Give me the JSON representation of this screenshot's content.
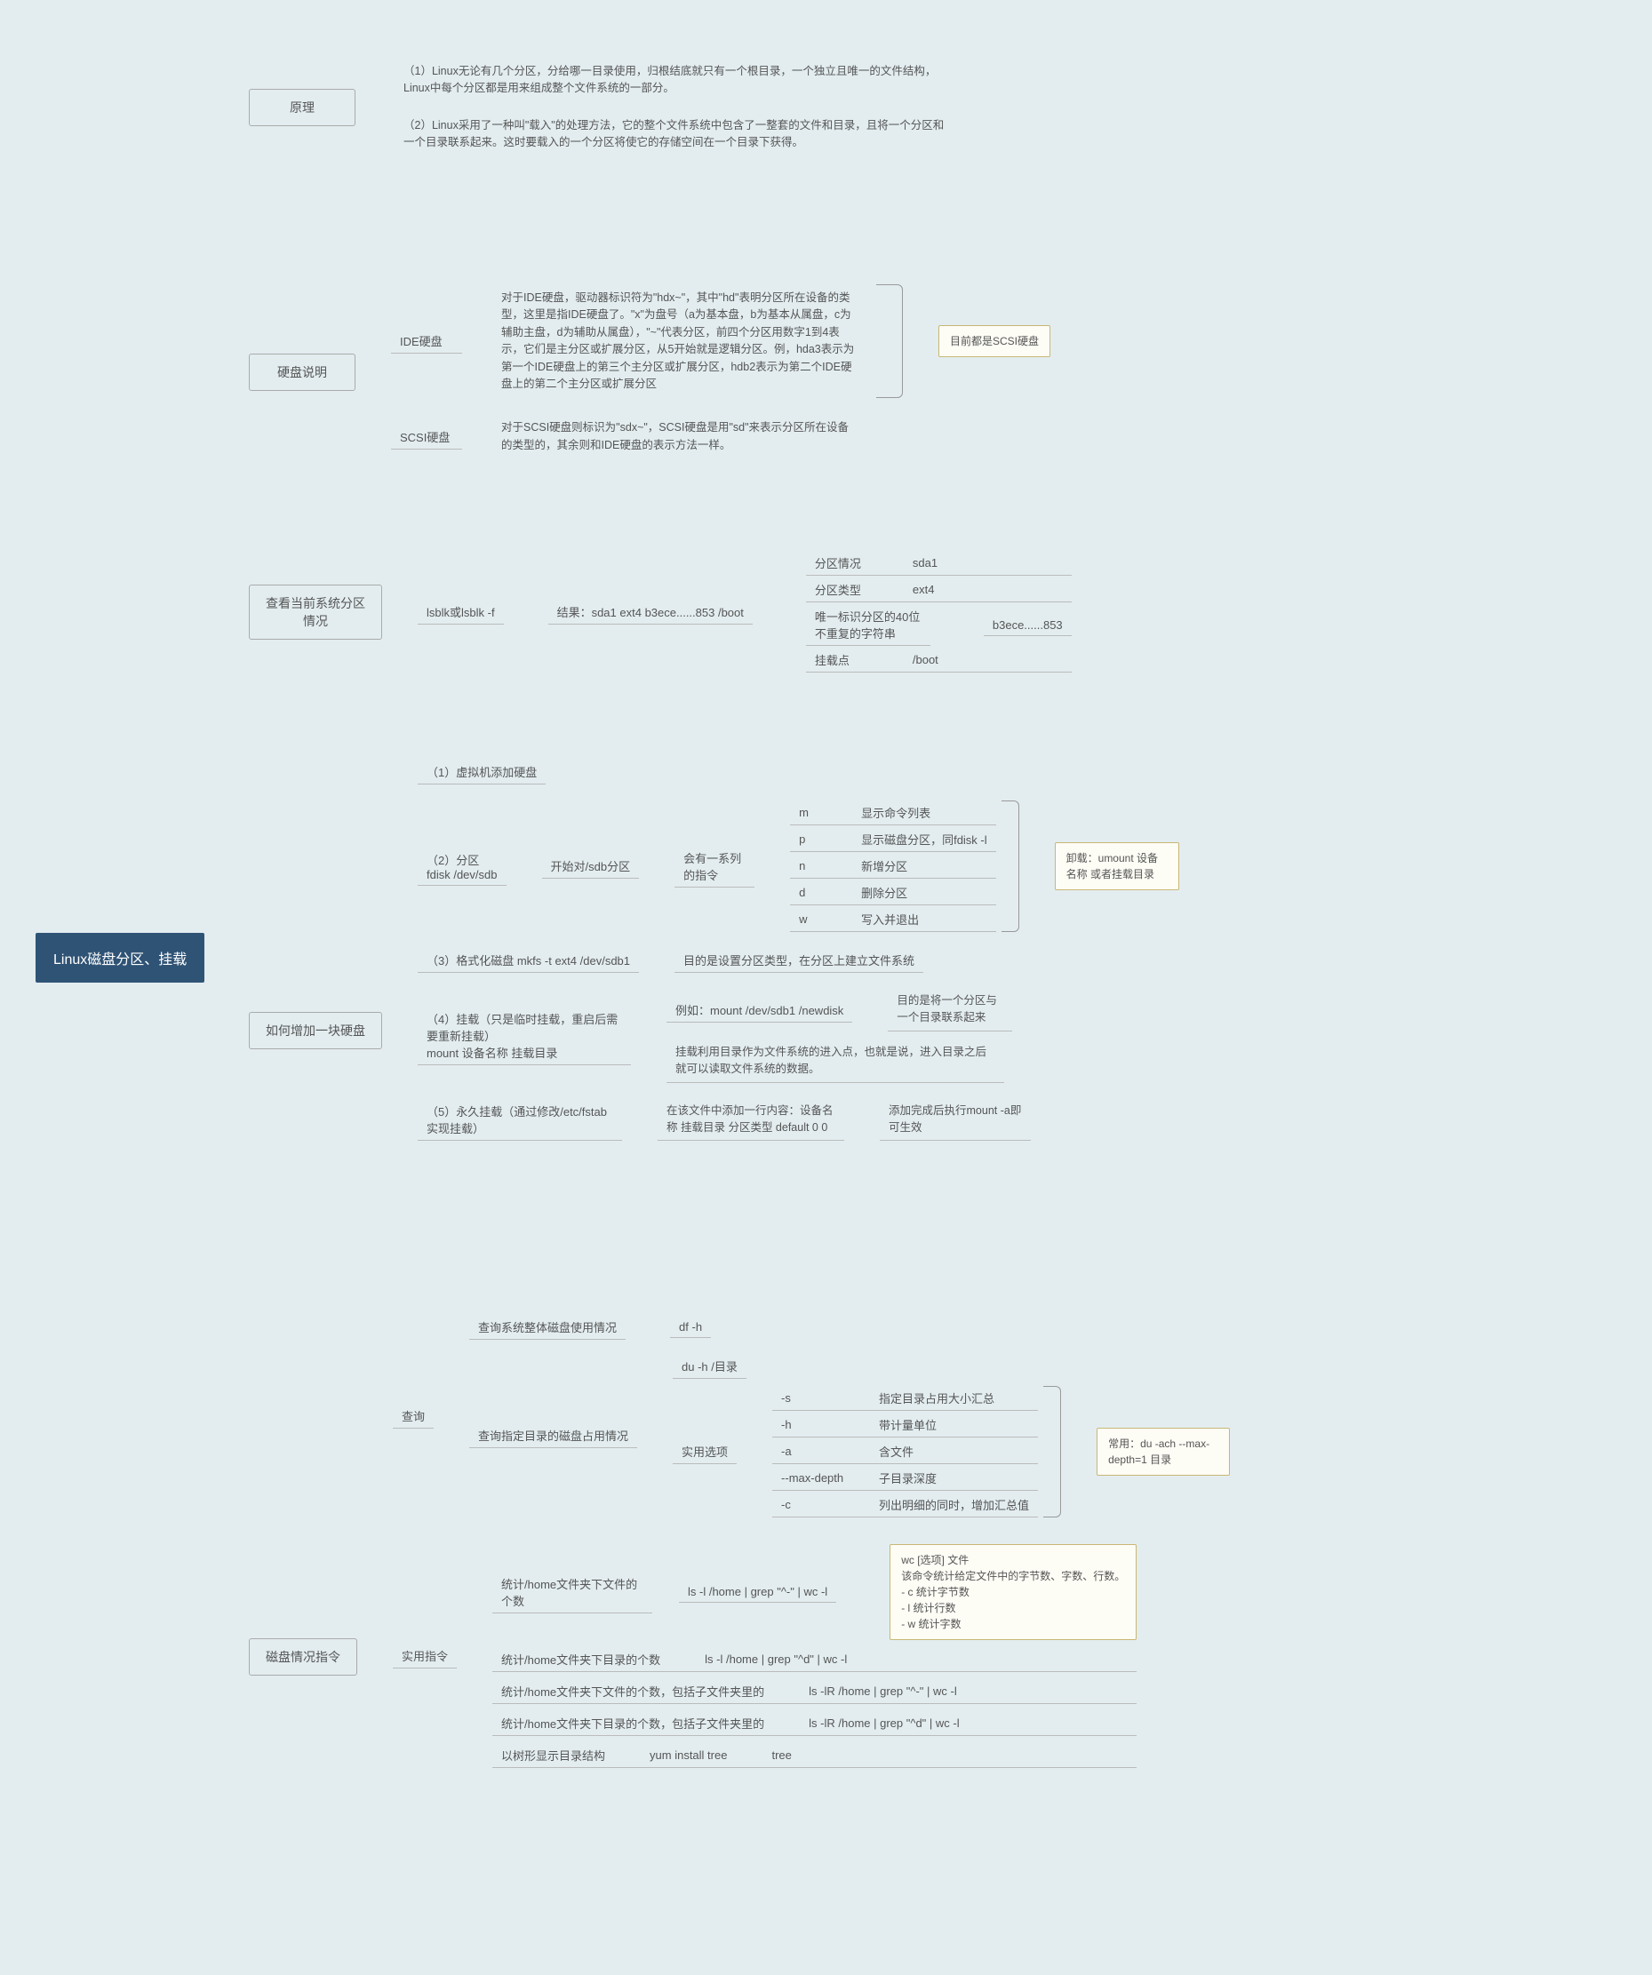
{
  "root": "Linux磁盘分区、挂载",
  "yuanli": {
    "title": "原理",
    "p1": "（1）Linux无论有几个分区，分给哪一目录使用，归根结底就只有一个根目录，一个独立且唯一的文件结构，Linux中每个分区都是用来组成整个文件系统的一部分。",
    "p2": "（2）Linux采用了一种叫\"载入\"的处理方法，它的整个文件系统中包含了一整套的文件和目录，且将一个分区和一个目录联系起来。这时要载入的一个分区将使它的存储空间在一个目录下获得。"
  },
  "disk": {
    "title": "硬盘说明",
    "ide": "IDE硬盘",
    "ide_text": "对于IDE硬盘，驱动器标识符为\"hdx~\"，其中\"hd\"表明分区所在设备的类型，这里是指IDE硬盘了。\"x\"为盘号（a为基本盘，b为基本从属盘，c为辅助主盘，d为辅助从属盘），\"~\"代表分区，前四个分区用数字1到4表示，它们是主分区或扩展分区，从5开始就是逻辑分区。例，hda3表示为第一个IDE硬盘上的第三个主分区或扩展分区，hdb2表示为第二个IDE硬盘上的第二个主分区或扩展分区",
    "scsi": "SCSI硬盘",
    "scsi_text": "对于SCSI硬盘则标识为\"sdx~\"，SCSI硬盘是用\"sd\"来表示分区所在设备的类型的，其余则和IDE硬盘的表示方法一样。",
    "note": "目前都是SCSI硬盘"
  },
  "lsblk": {
    "title": "查看当前系统分区情况",
    "cmd": "lsblk或lsblk -f",
    "res": "结果：sda1 ext4 b3ece......853 /boot",
    "items": {
      "a_lbl": "分区情况",
      "a_val": "sda1",
      "b_lbl": "分区类型",
      "b_val": "ext4",
      "c_lbl": "唯一标识分区的40位不重复的字符串",
      "c_val": "b3ece......853",
      "d_lbl": "挂载点",
      "d_val": "/boot"
    }
  },
  "add": {
    "title": "如何增加一块硬盘",
    "s1": "（1）虚拟机添加硬盘",
    "s2": "（2）分区\nfdisk /dev/sdb",
    "s2_a": "开始对/sdb分区",
    "s2_b": "会有一系列的指令",
    "s2_m_k": "m",
    "s2_m_v": "显示命令列表",
    "s2_p_k": "p",
    "s2_p_v": "显示磁盘分区，同fdisk -l",
    "s2_n_k": "n",
    "s2_n_v": "新增分区",
    "s2_d_k": "d",
    "s2_d_v": "删除分区",
    "s2_w_k": "w",
    "s2_w_v": "写入并退出",
    "s3": "（3）格式化磁盘 mkfs -t ext4 /dev/sdb1",
    "s3_r": "目的是设置分区类型，在分区上建立文件系统",
    "s4": "（4）挂载（只是临时挂载，重启后需要重新挂载）\nmount 设备名称 挂载目录",
    "s4_a": "例如：mount /dev/sdb1 /newdisk",
    "s4_ar": "目的是将一个分区与一个目录联系起来",
    "s4_b": "挂载利用目录作为文件系统的进入点，也就是说，进入目录之后就可以读取文件系统的数据。",
    "s5": "（5）永久挂载（通过修改/etc/fstab实现挂载）",
    "s5_a": "在该文件中添加一行内容：设备名称 挂载目录 分区类型 default 0 0",
    "s5_b": "添加完成后执行mount -a即可生效",
    "note": "卸载：umount 设备名称 或者挂载目录"
  },
  "dc": {
    "title": "磁盘情况指令",
    "query": "查询",
    "q1": "查询系统整体磁盘使用情况",
    "q1_cmd": "df -h",
    "q2": "查询指定目录的磁盘占用情况",
    "q2_a": "du -h /目录",
    "q2_opt": "实用选项",
    "opt_s_k": "-s",
    "opt_s_v": "指定目录占用大小汇总",
    "opt_h_k": "-h",
    "opt_h_v": "带计量单位",
    "opt_a_k": "-a",
    "opt_a_v": "含文件",
    "opt_md_k": "--max-depth",
    "opt_md_v": "子目录深度",
    "opt_c_k": "-c",
    "opt_c_v": "列出明细的同时，增加汇总值",
    "note_du": "常用：du -ach --max-depth=1 目录",
    "util": "实用指令",
    "u1_a": "统计/home文件夹下文件的个数",
    "u1_b": "ls -l /home | grep \"^-\" | wc -l",
    "u2_a": "统计/home文件夹下目录的个数",
    "u2_b": "ls -l /home | grep \"^d\" | wc -l",
    "u3_a": "统计/home文件夹下文件的个数，包括子文件夹里的",
    "u3_b": "ls -lR /home | grep \"^-\" | wc -l",
    "u4_a": "统计/home文件夹下目录的个数，包括子文件夹里的",
    "u4_b": "ls -lR /home | grep \"^d\" | wc -l",
    "u5_a": "以树形显示目录结构",
    "u5_b": "yum install tree",
    "u5_c": "tree",
    "note_wc": "wc [选项] 文件\n该命令统计给定文件中的字节数、字数、行数。\n- c 统计字节数\n- l 统计行数\n- w 统计字数"
  }
}
